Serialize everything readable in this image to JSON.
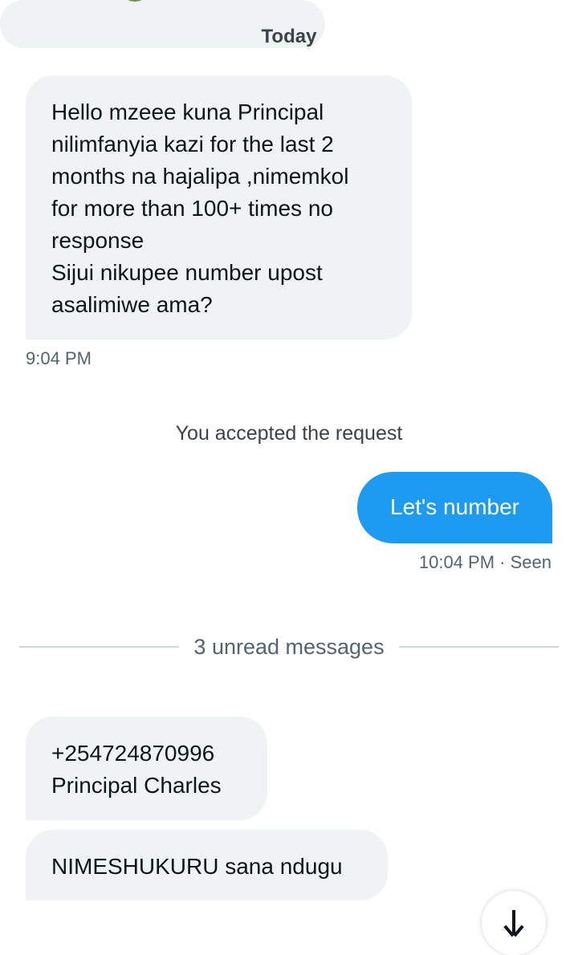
{
  "conversation": {
    "day_label": "Today",
    "messages": [
      {
        "direction": "incoming",
        "text": "Hello mzeee kuna Principal\nnilimfanyia kazi for the last 2\nmonths na hajalipa ,nimemkol\nfor more than 100+ times no\nresponse\nSijui nikupee number upost\nasalimiwe ama?",
        "time": "9:04 PM"
      },
      {
        "direction": "outgoing",
        "text": "Let's number",
        "time": "10:04 PM · Seen"
      },
      {
        "direction": "incoming",
        "text": "+254724870996\nPrincipal Charles"
      },
      {
        "direction": "incoming",
        "text": "NIMESHUKURU sana ndugu"
      }
    ],
    "system_note": "You accepted the request",
    "unread_divider": "3 unread messages"
  },
  "controls": {
    "scroll_down_icon": "arrow-down-icon"
  },
  "colors": {
    "incoming_bubble": "#eff3f4",
    "outgoing_bubble": "#1d9bf0",
    "secondary_text": "#536471"
  }
}
